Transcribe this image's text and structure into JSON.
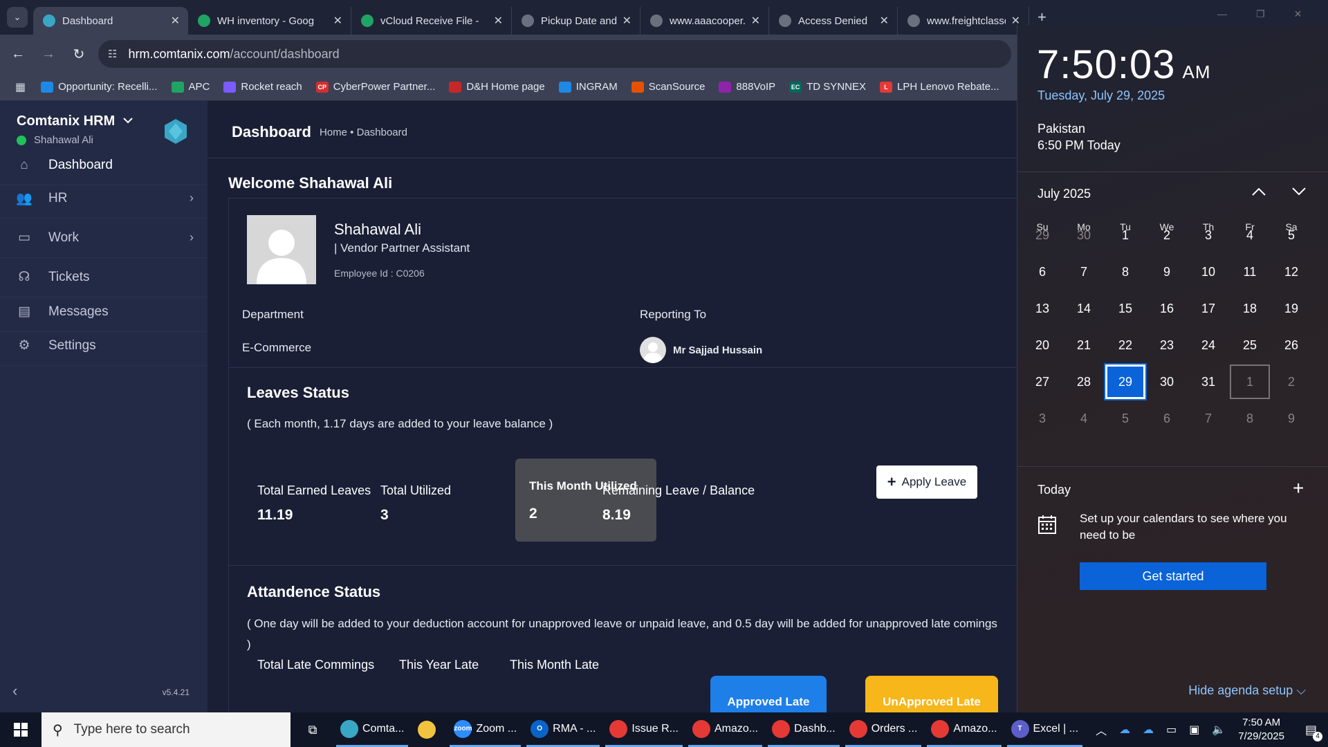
{
  "browser": {
    "tabs": [
      {
        "label": "Dashboard",
        "active": true,
        "icon": "comtanix-icon",
        "color": "#3aa6c6"
      },
      {
        "label": "WH inventory - Goog",
        "icon": "sheets-icon",
        "color": "#1fa463"
      },
      {
        "label": "vCloud Receive File -",
        "icon": "sheets-icon",
        "color": "#1fa463"
      },
      {
        "label": "Pickup Date and Time",
        "icon": "openai-icon",
        "color": "#6b6f7e"
      },
      {
        "label": "www.aaacooper.com",
        "icon": "page-icon",
        "color": "#6b6f7e"
      },
      {
        "label": "Access Denied",
        "icon": "globe-icon",
        "color": "#6b6f7e"
      },
      {
        "label": "www.freightclasscalc",
        "icon": "fcc-icon",
        "color": "#6b6f7e"
      }
    ],
    "url_host": "hrm.comtanix.com",
    "url_path": "/account/dashboard",
    "bookmarks": [
      {
        "label": "Opportunity: Recelli...",
        "color": "#1e88e5"
      },
      {
        "label": "APC",
        "color": "#1fa463"
      },
      {
        "label": "Rocket reach",
        "color": "#7b5cff"
      },
      {
        "label": "CyberPower Partner...",
        "color": "#d32f2f",
        "text": "CP"
      },
      {
        "label": "D&H Home page",
        "color": "#c62828"
      },
      {
        "label": "INGRAM",
        "color": "#1e88e5"
      },
      {
        "label": "ScanSource",
        "color": "#e65100"
      },
      {
        "label": "888VoIP",
        "color": "#8e24aa"
      },
      {
        "label": "TD SYNNEX",
        "color": "#00695c",
        "text": "EC"
      },
      {
        "label": "LPH Lenovo Rebate...",
        "color": "#e53935",
        "text": "L"
      }
    ]
  },
  "sidebar": {
    "brand": "Comtanix HRM",
    "user": "Shahawal Ali",
    "version": "v5.4.21",
    "items": [
      {
        "label": "Dashboard",
        "icon": "home-icon",
        "active": true,
        "chevron": false
      },
      {
        "label": "HR",
        "icon": "users-icon",
        "chevron": true
      },
      {
        "label": "Work",
        "icon": "briefcase-icon",
        "chevron": true
      },
      {
        "label": "Tickets",
        "icon": "headset-icon",
        "chevron": false
      },
      {
        "label": "Messages",
        "icon": "message-icon",
        "chevron": false
      },
      {
        "label": "Settings",
        "icon": "gear-icon",
        "chevron": false
      }
    ]
  },
  "main": {
    "title": "Dashboard",
    "breadcrumb": "Home • Dashboard",
    "welcome": "Welcome Shahawal Ali",
    "employee": {
      "name": "Shahawal Ali",
      "role": "| Vendor Partner Assistant",
      "id": "Employee Id : C0206",
      "department_label": "Department",
      "department": "E-Commerce",
      "reporting_label": "Reporting To",
      "reporting_to": "Mr Sajjad Hussain"
    },
    "leaves": {
      "title": "Leaves Status",
      "note": "( Each month, 1.17 days are added to your leave balance )",
      "total_earned_label": "Total Earned Leaves",
      "total_earned": "11.19",
      "total_utilized_label": "Total Utilized",
      "total_utilized": "3",
      "month_utilized_label": "This Month Utilized",
      "month_utilized": "2",
      "remaining_label": "Remaining Leave / Balance",
      "remaining": "8.19",
      "apply_label": "Apply Leave"
    },
    "attendance": {
      "title": "Attandence Status",
      "note": "( One day will be added to your deduction account for unapproved leave or unpaid leave, and 0.5 day will be added for unapproved late comings )",
      "total_late_label": "Total Late Commings",
      "year_late_label": "This Year Late",
      "month_late_label": "This Month Late",
      "approved_label": "Approved Late",
      "unapproved_label": "UnApproved Late"
    }
  },
  "flyout": {
    "time": "7:50:03",
    "ampm": "AM",
    "date": "Tuesday, July 29, 2025",
    "zone": "Pakistan",
    "zone_time": "6:50 PM Today",
    "month": "July 2025",
    "dow": [
      "Su",
      "Mo",
      "Tu",
      "We",
      "Th",
      "Fr",
      "Sa"
    ],
    "weeks": [
      [
        "29",
        "30",
        "1",
        "2",
        "3",
        "4",
        "5"
      ],
      [
        "6",
        "7",
        "8",
        "9",
        "10",
        "11",
        "12"
      ],
      [
        "13",
        "14",
        "15",
        "16",
        "17",
        "18",
        "19"
      ],
      [
        "20",
        "21",
        "22",
        "23",
        "24",
        "25",
        "26"
      ],
      [
        "27",
        "28",
        "29",
        "30",
        "31",
        "1",
        "2"
      ],
      [
        "3",
        "4",
        "5",
        "6",
        "7",
        "8",
        "9"
      ]
    ],
    "today_label": "Today",
    "agenda_msg": "Set up your calendars to see where you need to be",
    "get_started": "Get started",
    "hide_agenda": "Hide agenda setup"
  },
  "taskbar": {
    "search_placeholder": "Type here to search",
    "apps": [
      {
        "label": "Comta...",
        "icon": "comtanix-icon",
        "color": "#3aa6c6"
      },
      {
        "label": "",
        "icon": "folder-icon",
        "color": "#f3c33f",
        "plain": true
      },
      {
        "label": "Zoom ...",
        "icon": "zoom-icon",
        "color": "#2d8cff",
        "text": "zoom"
      },
      {
        "label": "RMA - ...",
        "icon": "outlook-icon",
        "color": "#0a64c8",
        "text": "O"
      },
      {
        "label": "Issue R...",
        "icon": "chrome-icon",
        "color": "#e53935"
      },
      {
        "label": "Amazo...",
        "icon": "chrome-icon",
        "color": "#e53935"
      },
      {
        "label": "Dashb...",
        "icon": "chrome-icon",
        "color": "#e53935"
      },
      {
        "label": "Orders ...",
        "icon": "chrome-icon",
        "color": "#e53935"
      },
      {
        "label": "Amazo...",
        "icon": "chrome-icon",
        "color": "#e53935"
      },
      {
        "label": "Excel | ...",
        "icon": "teams-icon",
        "color": "#5b5fc7",
        "text": "T"
      }
    ],
    "clock_time": "7:50 AM",
    "clock_date": "7/29/2025",
    "notif_count": "4"
  }
}
